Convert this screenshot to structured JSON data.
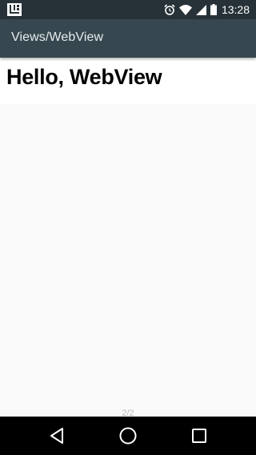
{
  "status_bar": {
    "time": "13:28",
    "icons": [
      "launcher-icon",
      "alarm-icon",
      "wifi-icon",
      "signal-icon",
      "battery-icon"
    ]
  },
  "app_bar": {
    "title": "Views/WebView"
  },
  "webview": {
    "heading": "Hello, WebView"
  },
  "page_indicator": "2/2",
  "nav_bar": {
    "buttons": [
      "back",
      "home",
      "recents"
    ]
  },
  "colors": {
    "status_bar": "#263238",
    "app_bar": "#37474f",
    "content_bg": "#f9f9f9",
    "nav_bar": "#000000"
  }
}
